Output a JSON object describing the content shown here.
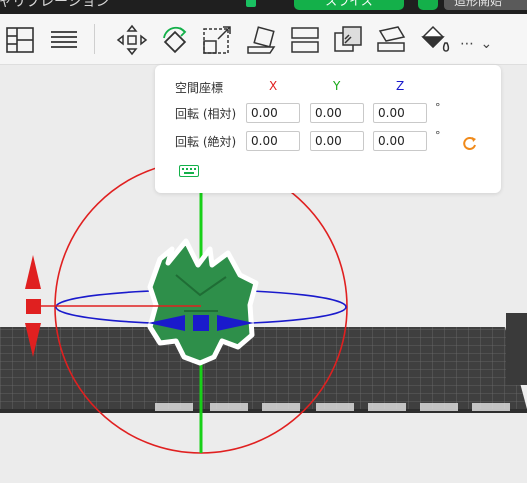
{
  "topbar": {
    "title_fragment": "ャリブレーション",
    "slice_label": "スライス",
    "print_label": "造形開始"
  },
  "toolbar": {
    "more_label": "⋯ ⌄",
    "tools": [
      "arrange-icon",
      "list-icon",
      "move-icon",
      "rotate-icon",
      "scale-icon",
      "fit-icon",
      "place-on-face-icon",
      "split-icon",
      "boolean-icon",
      "cut-icon",
      "support-paint-icon",
      "seam-paint-icon",
      "more-icon"
    ]
  },
  "rotation_panel": {
    "title": "空間座標",
    "axes": {
      "x": "X",
      "y": "Y",
      "z": "Z"
    },
    "rotate_rel_label": "回転 (相対)",
    "rotate_abs_label": "回転 (絶対)",
    "rel": {
      "x": "0.00",
      "y": "0.00",
      "z": "0.00"
    },
    "abs": {
      "x": "0.00",
      "y": "0.00",
      "z": "0.00"
    },
    "degree_symbol": "°"
  },
  "colors": {
    "accent_green": "#14b04a",
    "axis_x": "#e02020",
    "axis_y": "#18a818",
    "axis_z": "#1a1acc",
    "model": "#2e8f4a"
  }
}
